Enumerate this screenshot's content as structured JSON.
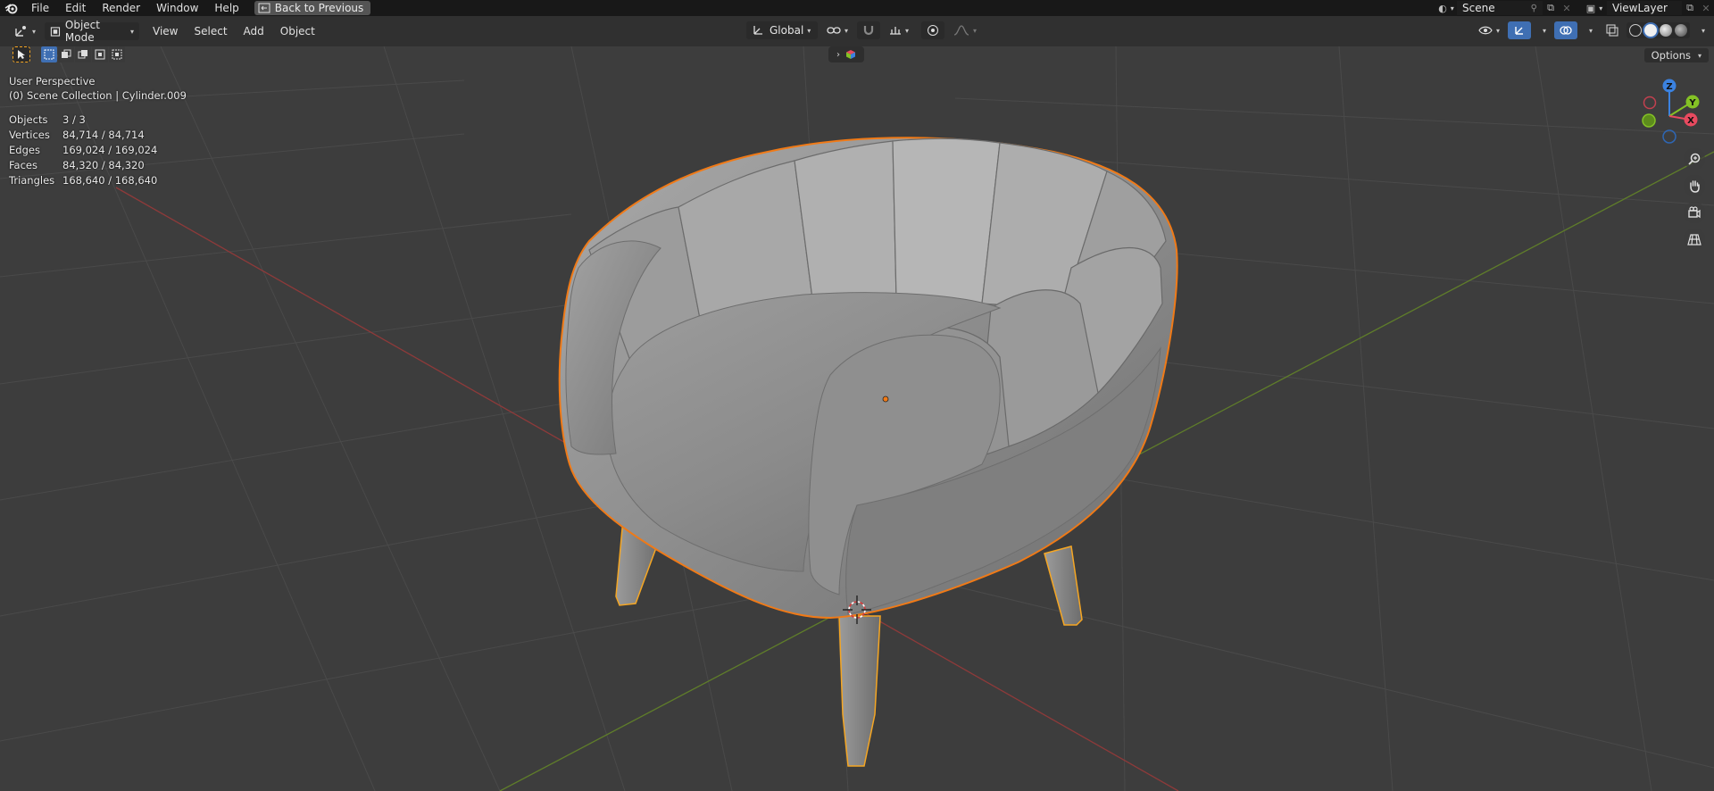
{
  "app": {
    "menu": [
      "File",
      "Edit",
      "Render",
      "Window",
      "Help"
    ],
    "back_label": "Back to Previous",
    "scene_name": "Scene",
    "view_layer": "ViewLayer"
  },
  "header": {
    "mode": "Object Mode",
    "menus": [
      "View",
      "Select",
      "Add",
      "Object"
    ],
    "orientation": "Global",
    "options_label": "Options"
  },
  "overlay": {
    "perspective": "User Perspective",
    "collection": "(0) Scene Collection | Cylinder.009",
    "stats": [
      {
        "label": "Objects",
        "value": "3 / 3"
      },
      {
        "label": "Vertices",
        "value": "84,714 / 84,714"
      },
      {
        "label": "Edges",
        "value": "169,024 / 169,024"
      },
      {
        "label": "Faces",
        "value": "84,320 / 84,320"
      },
      {
        "label": "Triangles",
        "value": "168,640 / 168,640"
      }
    ]
  },
  "gizmo": {
    "z_label": "Z",
    "y_label": "Y",
    "x_label": "X",
    "colors": {
      "x": "#e84a5f",
      "y": "#84c225",
      "z": "#3b82e0"
    }
  },
  "colors": {
    "accent_blue": "#3f6fb3",
    "selection_orange": "#f07a17",
    "active_outline": "#f5a623"
  }
}
